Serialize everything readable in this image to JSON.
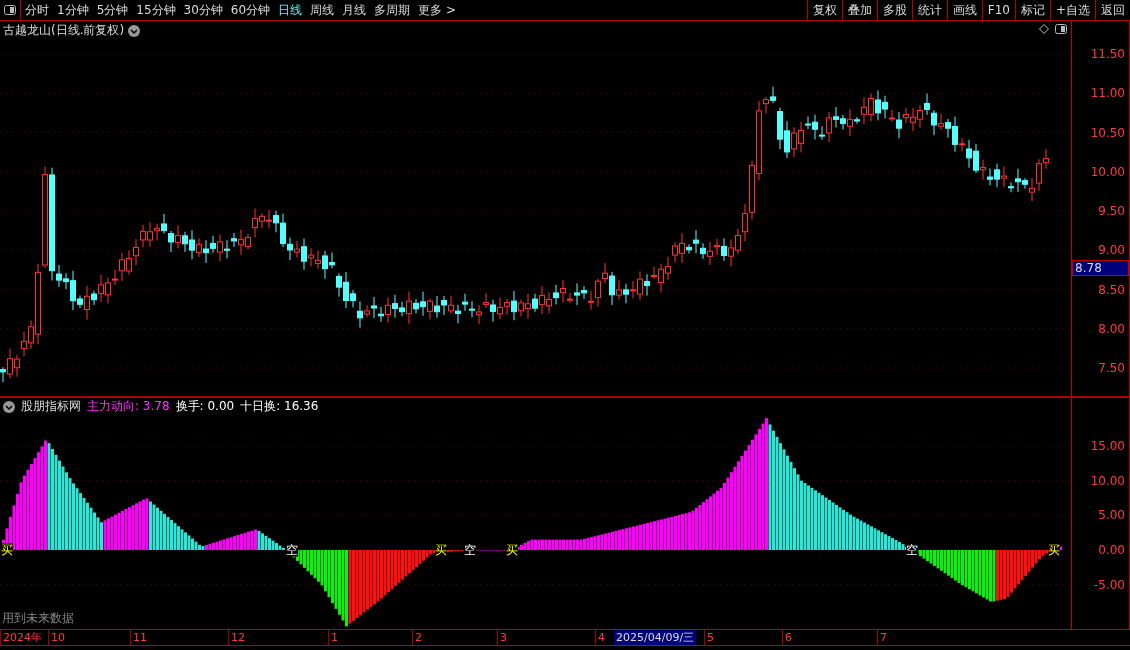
{
  "toolbar": {
    "periods": [
      {
        "label": "分时",
        "selected": false
      },
      {
        "label": "1分钟",
        "selected": false
      },
      {
        "label": "5分钟",
        "selected": false
      },
      {
        "label": "15分钟",
        "selected": false
      },
      {
        "label": "30分钟",
        "selected": false
      },
      {
        "label": "60分钟",
        "selected": false
      },
      {
        "label": "日线",
        "selected": true
      },
      {
        "label": "周线",
        "selected": false
      },
      {
        "label": "月线",
        "selected": false
      },
      {
        "label": "多周期",
        "selected": false
      },
      {
        "label": "更多 >",
        "selected": false
      }
    ],
    "buttons": [
      "复权",
      "叠加",
      "多股",
      "统计",
      "画线",
      "F10",
      "标记",
      "+自选",
      "返回"
    ]
  },
  "price_chart": {
    "title": "古越龙山(日线.前复权)",
    "axis_labels": [
      "11.50",
      "11.00",
      "10.50",
      "10.00",
      "9.50",
      "9.00",
      "8.50",
      "8.00",
      "7.50"
    ],
    "current_price": "8.78"
  },
  "indicator": {
    "name": "股朋指标网",
    "values": [
      {
        "label": "主力动向: 3.78",
        "color": "#ff33ff"
      },
      {
        "label": "换手: 0.00",
        "color": "#ffffff"
      },
      {
        "label": "十日换: 16.36",
        "color": "#ffffff"
      }
    ],
    "axis_labels": [
      "15.00",
      "10.00",
      "5.00",
      "0.00",
      "-5.00"
    ],
    "signals": [
      {
        "text": "买",
        "kind": "buy"
      },
      {
        "text": "空",
        "kind": "sell"
      },
      {
        "text": "买",
        "kind": "buy"
      },
      {
        "text": "空",
        "kind": "sell"
      },
      {
        "text": "买",
        "kind": "buy"
      },
      {
        "text": "空",
        "kind": "sell"
      },
      {
        "text": "买",
        "kind": "buy"
      }
    ],
    "note": "用到未来数据"
  },
  "date_axis": {
    "labels": [
      {
        "text": "2024年",
        "selected": false
      },
      {
        "text": "10",
        "selected": false
      },
      {
        "text": "11",
        "selected": false
      },
      {
        "text": "12",
        "selected": false
      },
      {
        "text": "1",
        "selected": false
      },
      {
        "text": "2",
        "selected": false
      },
      {
        "text": "3",
        "selected": false
      },
      {
        "text": "4",
        "selected": false
      },
      {
        "text": "2025/04/09/三",
        "selected": true
      },
      {
        "text": "5",
        "selected": false
      },
      {
        "text": "6",
        "selected": false
      },
      {
        "text": "7",
        "selected": false
      }
    ]
  }
}
